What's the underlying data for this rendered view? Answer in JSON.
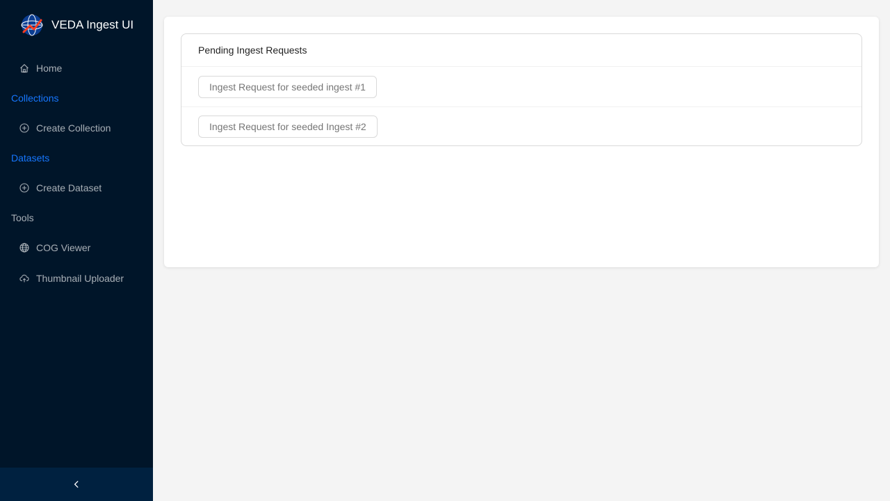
{
  "app": {
    "title": "VEDA Ingest UI"
  },
  "sidebar": {
    "home_label": "Home",
    "groups": [
      {
        "label": "Collections",
        "item_label": "Create Collection"
      },
      {
        "label": "Datasets",
        "item_label": "Create Dataset"
      },
      {
        "label": "Tools",
        "items": [
          "COG Viewer",
          "Thumbnail Uploader"
        ]
      }
    ],
    "active_color": "#1677ff",
    "background": "#001529"
  },
  "main": {
    "list_title": "Pending Ingest Requests",
    "requests": [
      "Ingest Request for seeded ingest #1",
      "Ingest Request for seeded Ingest #2"
    ]
  },
  "icons": {
    "home": "home-icon",
    "create": "plus-circle-icon",
    "viewer": "globe-icon",
    "upload": "cloud-upload-icon",
    "collapse": "chevron-left-icon"
  }
}
